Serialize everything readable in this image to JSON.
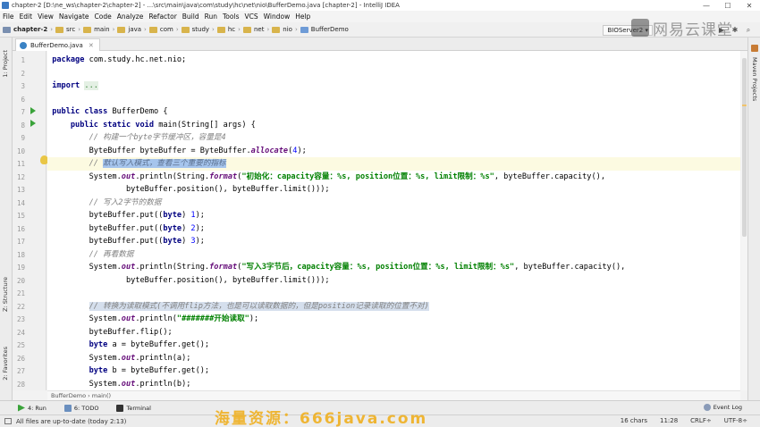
{
  "window": {
    "title": "chapter-2 [D:\\ne_ws\\chapter-2\\chapter-2] - ...\\src\\main\\java\\com\\study\\hc\\net\\nio\\BufferDemo.java [chapter-2] - IntelliJ IDEA",
    "controls": [
      "—",
      "☐",
      "✕"
    ]
  },
  "menu": [
    "File",
    "Edit",
    "View",
    "Navigate",
    "Code",
    "Analyze",
    "Refactor",
    "Build",
    "Run",
    "Tools",
    "VCS",
    "Window",
    "Help"
  ],
  "breadcrumbs": [
    "chapter-2",
    "src",
    "main",
    "java",
    "com",
    "study",
    "hc",
    "net",
    "nio",
    "BufferDemo"
  ],
  "run_config": "BIOServer2 ▾",
  "watermark_logo": "网易云课堂",
  "watermark_bottom": "海量资源：666java.com",
  "left_tabs": [
    "1: Project",
    "Z: Structure",
    "2: Favorites"
  ],
  "right_tabs": [
    "Maven Projects"
  ],
  "editor_tab": "BufferDemo.java",
  "code_lines": [
    {
      "n": "1",
      "html": "<span class='kw'>package</span> com.study.hc.net.nio;"
    },
    {
      "n": "2",
      "html": ""
    },
    {
      "n": "3",
      "html": "<span class='kw'>import</span> <span class='fold'>...</span>"
    },
    {
      "n": "6",
      "html": ""
    },
    {
      "n": "7",
      "html": "<span class='kw'>public class</span> BufferDemo {"
    },
    {
      "n": "8",
      "html": "    <span class='kw'>public static void</span> main(String[] args) {"
    },
    {
      "n": "9",
      "html": "        <span class='cm'>// 构建一个byte字节缓冲区，容量是4</span>"
    },
    {
      "n": "10",
      "html": "        ByteBuffer byteBuffer = ByteBuffer.<span class='it'>allocate</span>(<span style='color:#0000ff'>4</span>);"
    },
    {
      "n": "11",
      "html": "        <span class='cm'>// <span class='sel'>默认写入模式，查看三个重要的指标</span></span>",
      "current": true
    },
    {
      "n": "12",
      "html": "        System.<span class='it'>out</span>.println(String.<span class='it'>format</span>(<span class='st'>\"初始化：capacity容量：%s, position位置：%s, limit限制：%s\"</span>, byteBuffer.capacity(),"
    },
    {
      "n": "13",
      "html": "                byteBuffer.position(), byteBuffer.limit()));"
    },
    {
      "n": "14",
      "html": "        <span class='cm'>// 写入2字节的数据</span>"
    },
    {
      "n": "15",
      "html": "        byteBuffer.put((<span class='kw'>byte</span>) <span style='color:#0000ff'>1</span>);"
    },
    {
      "n": "16",
      "html": "        byteBuffer.put((<span class='kw'>byte</span>) <span style='color:#0000ff'>2</span>);"
    },
    {
      "n": "17",
      "html": "        byteBuffer.put((<span class='kw'>byte</span>) <span style='color:#0000ff'>3</span>);"
    },
    {
      "n": "18",
      "html": "        <span class='cm'>// 再看数据</span>"
    },
    {
      "n": "19",
      "html": "        System.<span class='it'>out</span>.println(String.<span class='it'>format</span>(<span class='st'>\"写入3字节后，capacity容量：%s, position位置：%s, limit限制：%s\"</span>, byteBuffer.capacity(),"
    },
    {
      "n": "20",
      "html": "                byteBuffer.position(), byteBuffer.limit()));"
    },
    {
      "n": "21",
      "html": ""
    },
    {
      "n": "22",
      "html": "        <span class='cm'><span class='csel'>// 转换为读取模式(不调用flip方法，也是可以读取数据的，但是position记录读取的位置不对)</span></span>"
    },
    {
      "n": "23",
      "html": "        System.<span class='it'>out</span>.println(<span class='st'>\"#######开始读取\"</span>);"
    },
    {
      "n": "24",
      "html": "        byteBuffer.flip();"
    },
    {
      "n": "25",
      "html": "        <span class='kw'>byte</span> a = byteBuffer.get();"
    },
    {
      "n": "26",
      "html": "        System.<span class='it'>out</span>.println(a);"
    },
    {
      "n": "27",
      "html": "        <span class='kw'>byte</span> b = byteBuffer.get();"
    },
    {
      "n": "28",
      "html": "        System.<span class='it'>out</span>.println(b);"
    }
  ],
  "code_breadcrumb": "BufferDemo  ›  main()",
  "tool_windows": [
    "4: Run",
    "6: TODO",
    "Terminal"
  ],
  "event_log": "Event Log",
  "status": {
    "message": "All files are up-to-date (today 2:13)",
    "chars": "16 chars",
    "position": "11:28",
    "line_sep": "CRLF÷",
    "encoding": "UTF-8÷"
  }
}
